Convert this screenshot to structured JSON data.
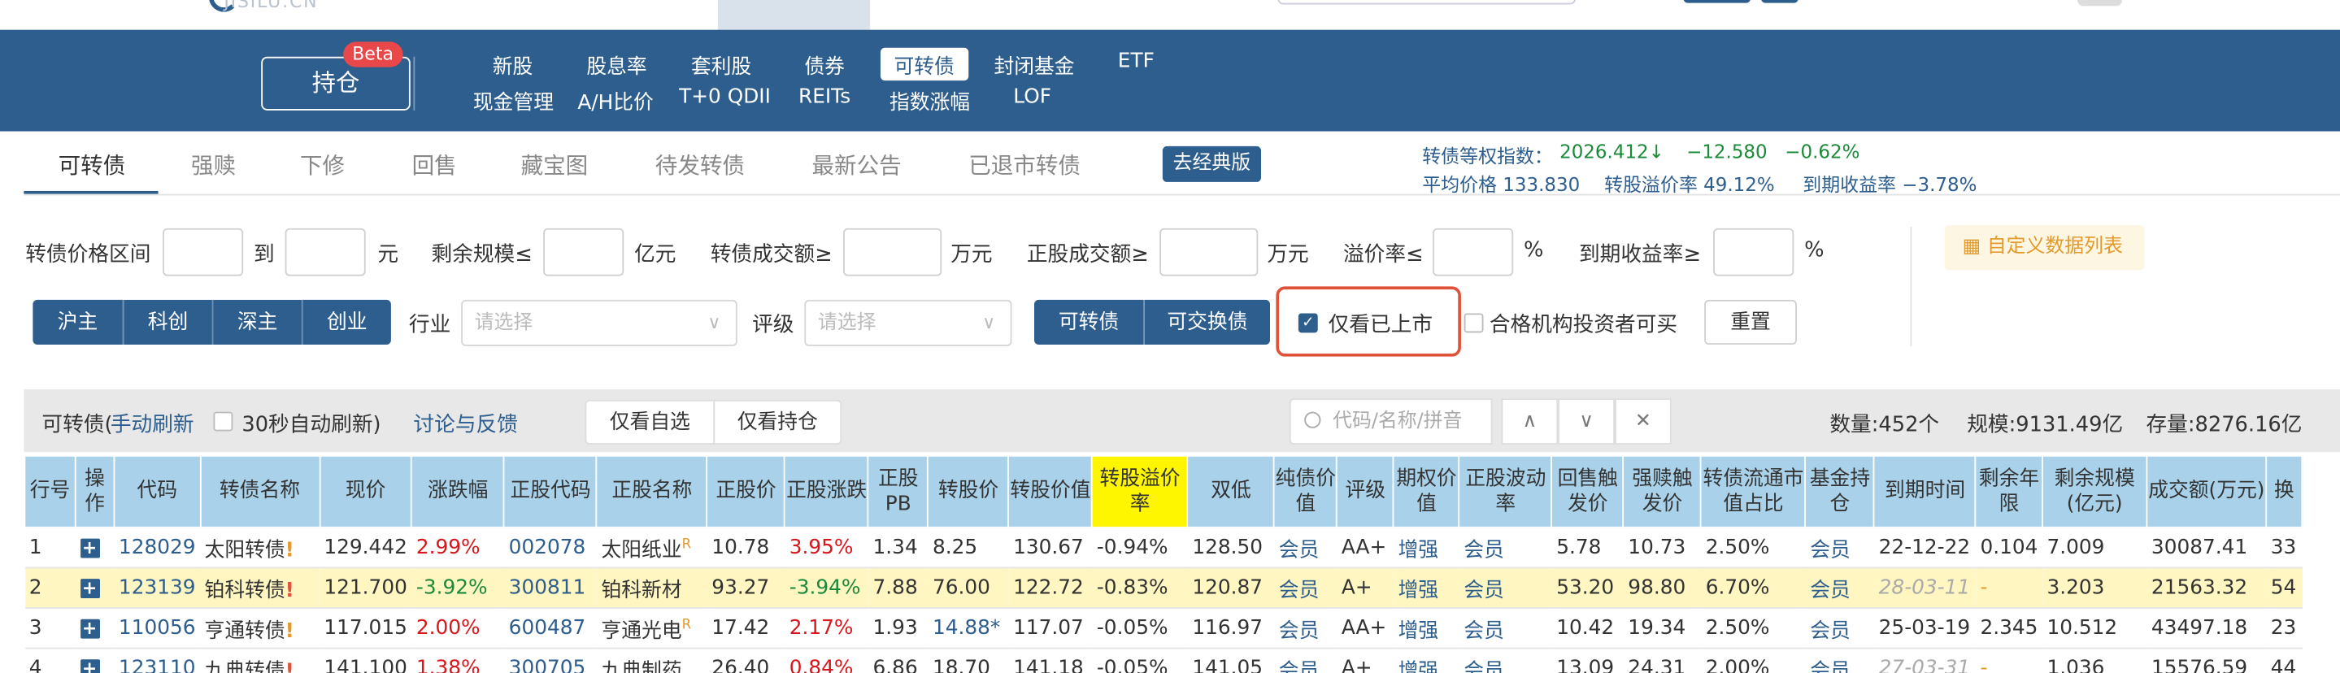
{
  "header": {
    "logo_text": "JISILU.CN",
    "hold_button": "持仓",
    "beta_badge": "Beta",
    "nav_row1": [
      "新股",
      "股息率",
      "套利股",
      "债券",
      "可转债",
      "封闭基金",
      "ETF"
    ],
    "nav_row2": [
      "现金管理",
      "A/H比价",
      "T+0 QDII",
      "REITs",
      "指数涨幅",
      "LOF"
    ],
    "active_nav": "可转债"
  },
  "subtabs": [
    "可转债",
    "强赎",
    "下修",
    "回售",
    "藏宝图",
    "待发转债",
    "最新公告",
    "已退市转债"
  ],
  "classic_button": "去经典版",
  "index_info": {
    "label": "转债等权指数：",
    "value": "2026.412↓",
    "change": "−12.580",
    "change_pct": "−0.62%",
    "avg_price": "平均价格 133.830",
    "avg_premium": "转股溢价率 49.12%",
    "ytm": "到期收益率 −3.78%"
  },
  "filters": {
    "price_range": "转债价格区间",
    "to": "到",
    "yuan": "元",
    "remaining_size": "剩余规模≤",
    "yi_yuan": "亿元",
    "bond_volume": "转债成交额≥",
    "wan_yuan": "万元",
    "stock_volume": "正股成交额≥",
    "wan_yuan2": "万元",
    "premium": "溢价率≤",
    "pct": "%",
    "ytm": "到期收益率≥",
    "pct2": "%",
    "custom_list": "自定义数据列表",
    "markets": [
      "沪主",
      "科创",
      "深主",
      "创业"
    ],
    "industry_label": "行业",
    "industry_placeholder": "请选择",
    "rating_label": "评级",
    "rating_placeholder": "请选择",
    "bond_types": [
      "可转债",
      "可交换债"
    ],
    "listed_only": "仅看已上市",
    "qualified_only": "合格机构投资者可买",
    "reset": "重置"
  },
  "toolbar": {
    "title": "可转债(",
    "manual_refresh": "手动刷新",
    "auto_refresh": "30秒自动刷新)",
    "feedback": "讨论与反馈",
    "watch_only": "仅看自选",
    "hold_only": "仅看持仓",
    "search_placeholder": "代码/名称/拼音",
    "count": "数量:452个",
    "scale": "规模:9131.49亿",
    "stock": "存量:8276.16亿"
  },
  "table": {
    "headers": [
      "行号",
      "操作",
      "代码",
      "转债名称",
      "现价",
      "涨跌幅",
      "正股代码",
      "正股名称",
      "正股价",
      "正股涨跌",
      "正股PB",
      "转股价",
      "转股价值",
      "转股溢价率",
      "双低",
      "纯债价值",
      "评级",
      "期权价值",
      "正股波动率",
      "回售触发价",
      "强赎触发价",
      "转债流通市值占比",
      "基金持仓",
      "到期时间",
      "剩余年限",
      "剩余规模(亿元)",
      "成交额(万元)",
      "换"
    ],
    "rows": [
      {
        "n": "1",
        "code": "128029",
        "name": "太阳转债",
        "price": "129.442",
        "chg": "2.99%",
        "scode": "002078",
        "sname": "太阳纸业",
        "sprice": "10.78",
        "schg": "3.95%",
        "pb": "1.34",
        "cprice": "8.25",
        "cval": "130.67",
        "prem": "-0.94%",
        "dl": "128.50",
        "bval": "会员",
        "rating": "AA+",
        "opt": "增强",
        "vol": "会员",
        "put": "5.78",
        "call": "10.73",
        "ratio": "2.50%",
        "fund": "会员",
        "due": "22-12-22",
        "yrs": "0.104",
        "size": "7.009",
        "amt": "30087.41",
        "turn": "33"
      },
      {
        "n": "2",
        "code": "123139",
        "name": "铂科转债",
        "price": "121.700",
        "chg": "-3.92%",
        "scode": "300811",
        "sname": "铂科新材",
        "sprice": "93.27",
        "schg": "-3.94%",
        "pb": "7.88",
        "cprice": "76.00",
        "cval": "122.72",
        "prem": "-0.83%",
        "dl": "120.87",
        "bval": "会员",
        "rating": "A+",
        "opt": "增强",
        "vol": "会员",
        "put": "53.20",
        "call": "98.80",
        "ratio": "6.70%",
        "fund": "会员",
        "due": "28-03-11",
        "yrs": "-",
        "size": "3.203",
        "amt": "21563.32",
        "turn": "54"
      },
      {
        "n": "3",
        "code": "110056",
        "name": "亨通转债",
        "price": "117.015",
        "chg": "2.00%",
        "scode": "600487",
        "sname": "亨通光电",
        "sprice": "17.42",
        "schg": "2.17%",
        "pb": "1.93",
        "cprice": "14.88*",
        "cval": "117.07",
        "prem": "-0.05%",
        "dl": "116.97",
        "bval": "会员",
        "rating": "AA+",
        "opt": "增强",
        "vol": "会员",
        "put": "10.42",
        "call": "19.34",
        "ratio": "2.50%",
        "fund": "会员",
        "due": "25-03-19",
        "yrs": "2.345",
        "size": "10.512",
        "amt": "43497.18",
        "turn": "23"
      },
      {
        "n": "4",
        "code": "123110",
        "name": "九典转债",
        "price": "141.100",
        "chg": "1.38%",
        "scode": "300705",
        "sname": "九典制药",
        "sprice": "26.40",
        "schg": "0.84%",
        "pb": "6.86",
        "cprice": "18.70",
        "cval": "141.18",
        "prem": "-0.05%",
        "dl": "141.05",
        "bval": "会员",
        "rating": "A+",
        "opt": "增强",
        "vol": "会员",
        "put": "13.09",
        "call": "24.31",
        "ratio": "2.00%",
        "fund": "会员",
        "due": "27-03-31",
        "yrs": "-",
        "size": "1.036",
        "amt": "15576.59",
        "turn": "44"
      }
    ]
  }
}
